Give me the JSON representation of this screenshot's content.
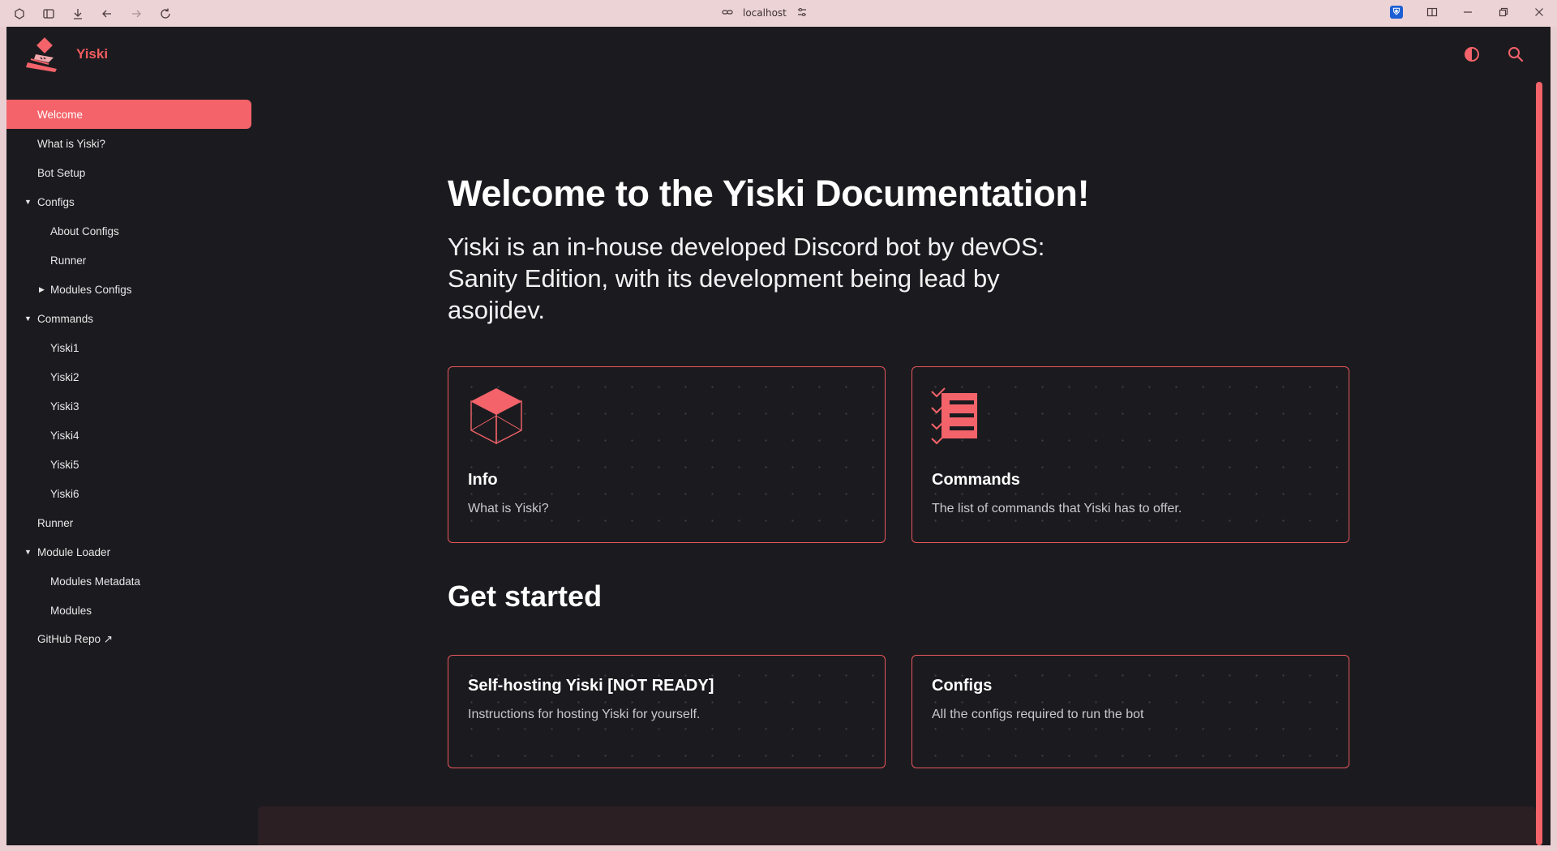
{
  "browser": {
    "url": "localhost"
  },
  "app": {
    "brand": "Yiski"
  },
  "sidebar": {
    "items": [
      {
        "label": "Welcome"
      },
      {
        "label": "What is Yiski?"
      },
      {
        "label": "Bot Setup"
      },
      {
        "label": "Configs"
      },
      {
        "label": "About Configs"
      },
      {
        "label": "Runner"
      },
      {
        "label": "Modules Configs"
      },
      {
        "label": "Commands"
      },
      {
        "label": "Yiski1"
      },
      {
        "label": "Yiski2"
      },
      {
        "label": "Yiski3"
      },
      {
        "label": "Yiski4"
      },
      {
        "label": "Yiski5"
      },
      {
        "label": "Yiski6"
      },
      {
        "label": "Runner"
      },
      {
        "label": "Module Loader"
      },
      {
        "label": "Modules Metadata"
      },
      {
        "label": "Modules"
      },
      {
        "label": "GitHub Repo ↗"
      }
    ]
  },
  "main": {
    "title": "Welcome to the Yiski Documentation!",
    "lead": "Yiski is an in-house developed Discord bot by devOS: Sanity Edition, with its development being lead by asojidev.",
    "feature_cards": [
      {
        "title": "Info",
        "desc": "What is Yiski?",
        "icon": "cube-icon"
      },
      {
        "title": "Commands",
        "desc": "The list of commands that Yiski has to offer.",
        "icon": "checklist-icon"
      }
    ],
    "get_started_heading": "Get started",
    "start_cards": [
      {
        "title": "Self-hosting Yiski [NOT READY]",
        "desc": "Instructions for hosting Yiski for yourself."
      },
      {
        "title": "Configs",
        "desc": "All the configs required to run the bot"
      }
    ]
  },
  "colors": {
    "accent": "#f4636a",
    "background": "#1b1b1f",
    "chrome": "#ecd3d6"
  }
}
